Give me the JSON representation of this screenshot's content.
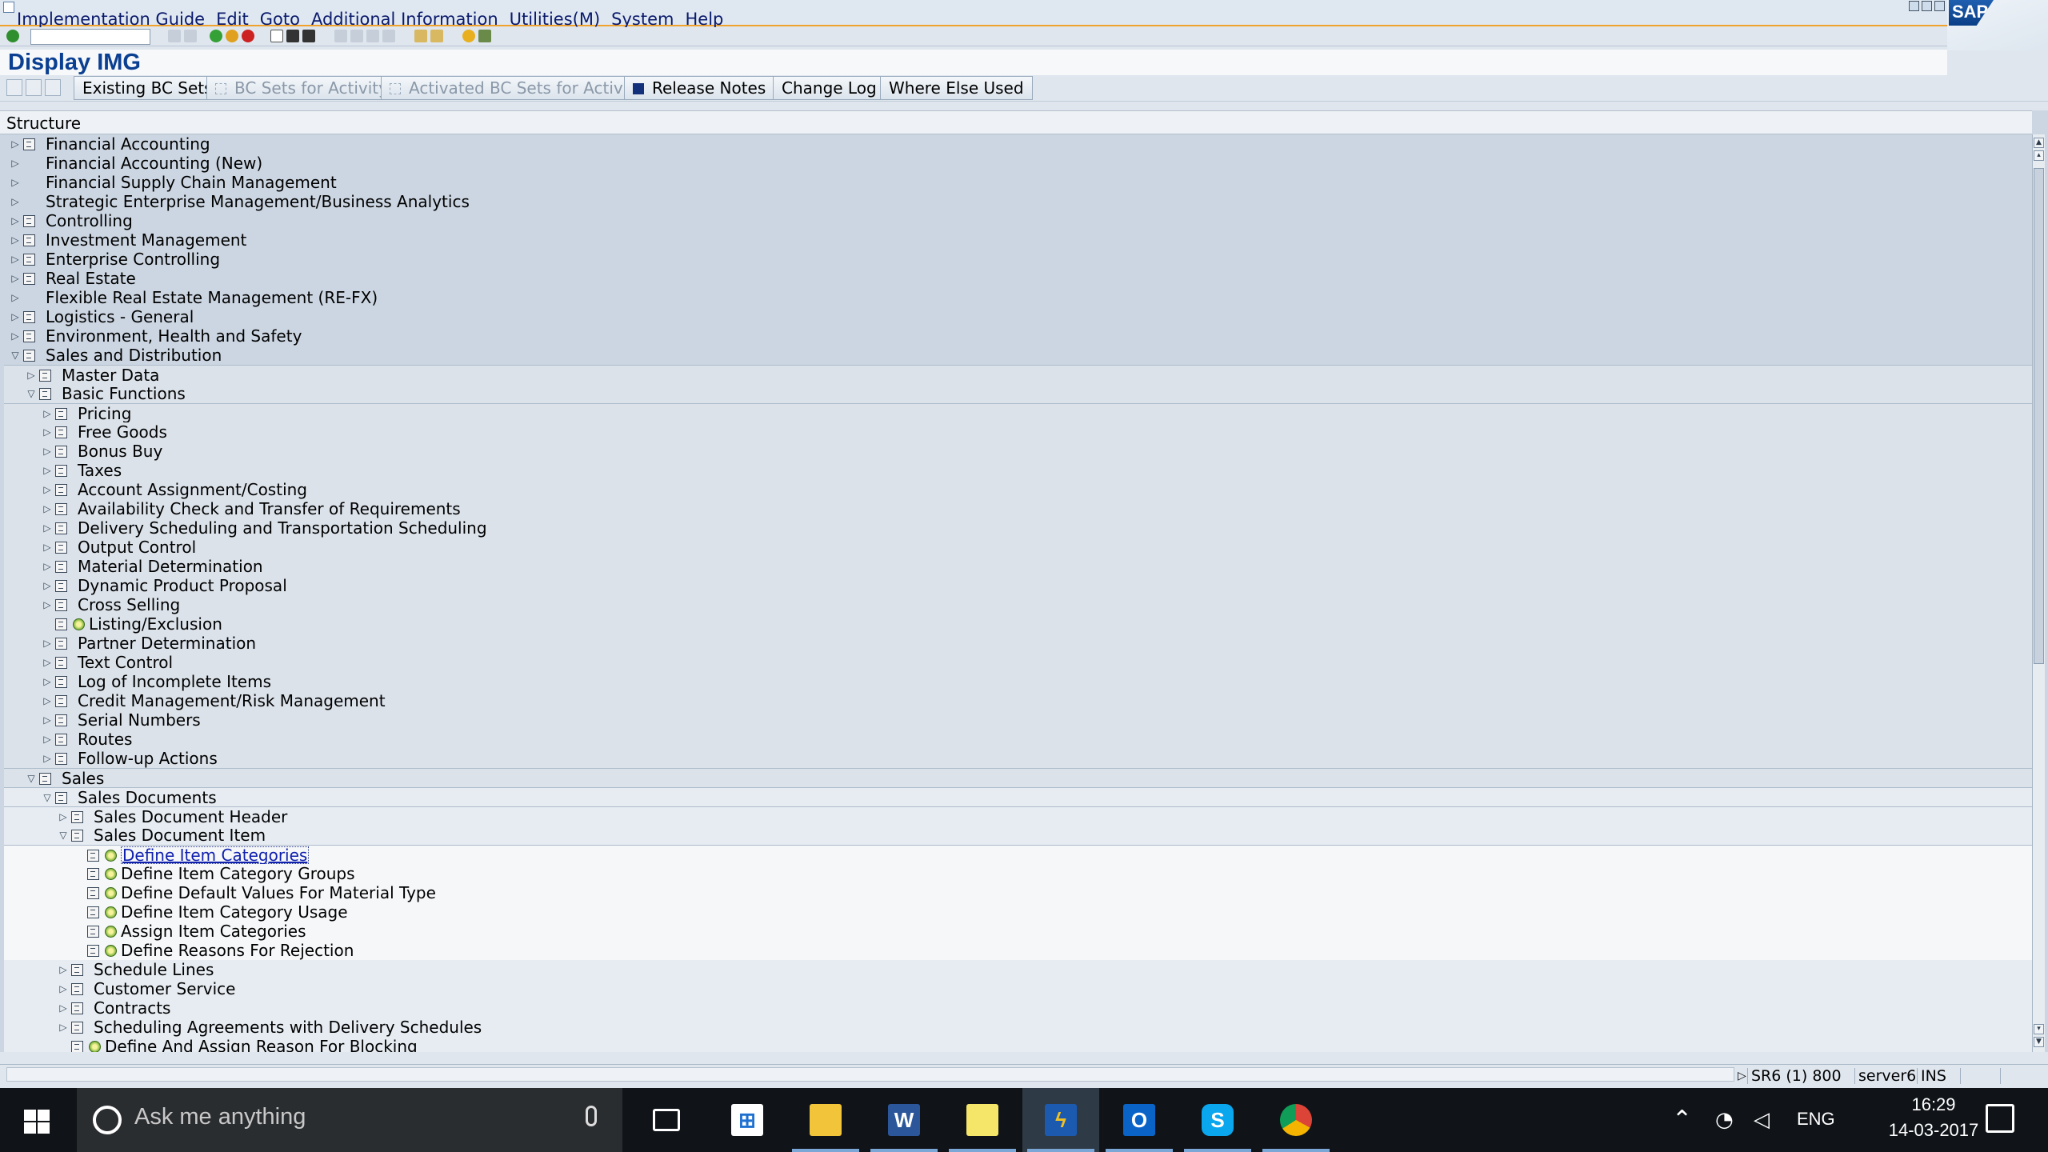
{
  "menu": [
    "Implementation Guide",
    "Edit",
    "Goto",
    "Additional Information",
    "Utilities(M)",
    "System",
    "Help"
  ],
  "logo": "SAP",
  "title": "Display IMG",
  "app_toolbar": {
    "existing_bc_sets": "Existing BC Sets",
    "bc_sets_for_activity": "BC Sets for Activity",
    "activated_bc_sets": "Activated BC Sets for Activity",
    "release_notes": "Release Notes",
    "change_log": "Change Log",
    "where_else_used": "Where Else Used"
  },
  "structure_header": "Structure",
  "tree": [
    {
      "label": "Financial Accounting",
      "level": 0,
      "expander": "collapsed",
      "doc": true,
      "act": false,
      "bg": 1
    },
    {
      "label": "Financial Accounting (New)",
      "level": 0,
      "expander": "collapsed",
      "doc": false,
      "act": false,
      "bg": 1
    },
    {
      "label": "Financial Supply Chain Management",
      "level": 0,
      "expander": "collapsed",
      "doc": false,
      "act": false,
      "bg": 1
    },
    {
      "label": "Strategic Enterprise Management/Business Analytics",
      "level": 0,
      "expander": "collapsed",
      "doc": false,
      "act": false,
      "bg": 1
    },
    {
      "label": "Controlling",
      "level": 0,
      "expander": "collapsed",
      "doc": true,
      "act": false,
      "bg": 1
    },
    {
      "label": "Investment Management",
      "level": 0,
      "expander": "collapsed",
      "doc": true,
      "act": false,
      "bg": 1
    },
    {
      "label": "Enterprise Controlling",
      "level": 0,
      "expander": "collapsed",
      "doc": true,
      "act": false,
      "bg": 1
    },
    {
      "label": "Real Estate",
      "level": 0,
      "expander": "collapsed",
      "doc": true,
      "act": false,
      "bg": 1
    },
    {
      "label": "Flexible Real Estate Management (RE-FX)",
      "level": 0,
      "expander": "collapsed",
      "doc": false,
      "act": false,
      "bg": 1
    },
    {
      "label": "Logistics - General",
      "level": 0,
      "expander": "collapsed",
      "doc": true,
      "act": false,
      "bg": 1
    },
    {
      "label": "Environment, Health and Safety",
      "level": 0,
      "expander": "collapsed",
      "doc": true,
      "act": false,
      "bg": 1
    },
    {
      "label": "Sales and Distribution",
      "level": 0,
      "expander": "expanded",
      "doc": true,
      "act": false,
      "bg": 1
    },
    {
      "label": "Master Data",
      "level": 1,
      "expander": "collapsed",
      "doc": true,
      "act": false,
      "bg": 2,
      "sep": true
    },
    {
      "label": "Basic Functions",
      "level": 1,
      "expander": "expanded",
      "doc": true,
      "act": false,
      "bg": 2
    },
    {
      "label": "Pricing",
      "level": 2,
      "expander": "collapsed",
      "doc": true,
      "act": false,
      "bg": 2,
      "sep": true
    },
    {
      "label": "Free Goods",
      "level": 2,
      "expander": "collapsed",
      "doc": true,
      "act": false,
      "bg": 2
    },
    {
      "label": "Bonus Buy",
      "level": 2,
      "expander": "collapsed",
      "doc": true,
      "act": false,
      "bg": 2
    },
    {
      "label": "Taxes",
      "level": 2,
      "expander": "collapsed",
      "doc": true,
      "act": false,
      "bg": 2
    },
    {
      "label": "Account Assignment/Costing",
      "level": 2,
      "expander": "collapsed",
      "doc": true,
      "act": false,
      "bg": 2
    },
    {
      "label": "Availability Check and Transfer of Requirements",
      "level": 2,
      "expander": "collapsed",
      "doc": true,
      "act": false,
      "bg": 2
    },
    {
      "label": "Delivery Scheduling and Transportation Scheduling",
      "level": 2,
      "expander": "collapsed",
      "doc": true,
      "act": false,
      "bg": 2
    },
    {
      "label": "Output Control",
      "level": 2,
      "expander": "collapsed",
      "doc": true,
      "act": false,
      "bg": 2
    },
    {
      "label": "Material Determination",
      "level": 2,
      "expander": "collapsed",
      "doc": true,
      "act": false,
      "bg": 2
    },
    {
      "label": "Dynamic Product Proposal",
      "level": 2,
      "expander": "collapsed",
      "doc": true,
      "act": false,
      "bg": 2
    },
    {
      "label": "Cross Selling",
      "level": 2,
      "expander": "collapsed",
      "doc": true,
      "act": false,
      "bg": 2
    },
    {
      "label": "Listing/Exclusion",
      "level": 2,
      "expander": "none",
      "doc": true,
      "act": true,
      "bg": 2
    },
    {
      "label": "Partner Determination",
      "level": 2,
      "expander": "collapsed",
      "doc": true,
      "act": false,
      "bg": 2
    },
    {
      "label": "Text Control",
      "level": 2,
      "expander": "collapsed",
      "doc": true,
      "act": false,
      "bg": 2
    },
    {
      "label": "Log of Incomplete Items",
      "level": 2,
      "expander": "collapsed",
      "doc": true,
      "act": false,
      "bg": 2
    },
    {
      "label": "Credit Management/Risk Management",
      "level": 2,
      "expander": "collapsed",
      "doc": true,
      "act": false,
      "bg": 2
    },
    {
      "label": "Serial Numbers",
      "level": 2,
      "expander": "collapsed",
      "doc": true,
      "act": false,
      "bg": 2
    },
    {
      "label": "Routes",
      "level": 2,
      "expander": "collapsed",
      "doc": true,
      "act": false,
      "bg": 2
    },
    {
      "label": "Follow-up Actions",
      "level": 2,
      "expander": "collapsed",
      "doc": true,
      "act": false,
      "bg": 2
    },
    {
      "label": "Sales",
      "level": 1,
      "expander": "expanded",
      "doc": true,
      "act": false,
      "bg": 2,
      "sep": true
    },
    {
      "label": "Sales Documents",
      "level": 2,
      "expander": "expanded",
      "doc": true,
      "act": false,
      "bg": 3,
      "sep": true
    },
    {
      "label": "Sales Document Header",
      "level": 3,
      "expander": "collapsed",
      "doc": true,
      "act": false,
      "bg": 3,
      "sep": true
    },
    {
      "label": "Sales Document Item",
      "level": 3,
      "expander": "expanded",
      "doc": true,
      "act": false,
      "bg": 3
    },
    {
      "label": "Define Item Categories",
      "level": 4,
      "expander": "none",
      "doc": true,
      "act": true,
      "bg": 4,
      "selected": true,
      "sep": true
    },
    {
      "label": "Define Item Category Groups",
      "level": 4,
      "expander": "none",
      "doc": true,
      "act": true,
      "bg": 4
    },
    {
      "label": "Define Default Values For Material Type",
      "level": 4,
      "expander": "none",
      "doc": true,
      "act": true,
      "bg": 4
    },
    {
      "label": "Define Item Category Usage",
      "level": 4,
      "expander": "none",
      "doc": true,
      "act": true,
      "bg": 4
    },
    {
      "label": "Assign Item Categories",
      "level": 4,
      "expander": "none",
      "doc": true,
      "act": true,
      "bg": 4
    },
    {
      "label": "Define Reasons For Rejection",
      "level": 4,
      "expander": "none",
      "doc": true,
      "act": true,
      "bg": 4
    },
    {
      "label": "Schedule Lines",
      "level": 3,
      "expander": "collapsed",
      "doc": true,
      "act": false,
      "bg": 3
    },
    {
      "label": "Customer Service",
      "level": 3,
      "expander": "collapsed",
      "doc": true,
      "act": false,
      "bg": 3
    },
    {
      "label": "Contracts",
      "level": 3,
      "expander": "collapsed",
      "doc": true,
      "act": false,
      "bg": 3
    },
    {
      "label": "Scheduling Agreements with Delivery Schedules",
      "level": 3,
      "expander": "collapsed",
      "doc": true,
      "act": false,
      "bg": 3
    },
    {
      "label": "Define And Assign Reason For Blocking",
      "level": 3,
      "expander": "none",
      "doc": true,
      "act": true,
      "bg": 3
    }
  ],
  "status": {
    "system": "SR6 (1) 800",
    "server": "server6",
    "mode": "INS"
  },
  "taskbar": {
    "search_placeholder": "Ask me anything",
    "apps": [
      "task-view",
      "store",
      "file-explorer",
      "word",
      "sticky-notes",
      "sap-logon",
      "outlook",
      "skype",
      "chrome"
    ],
    "language": "ENG",
    "time": "16:29",
    "date": "14-03-2017"
  },
  "colors": {
    "title": "#0b3f91",
    "menu_underline": "#f0a22c",
    "link": "#0f1fae"
  }
}
